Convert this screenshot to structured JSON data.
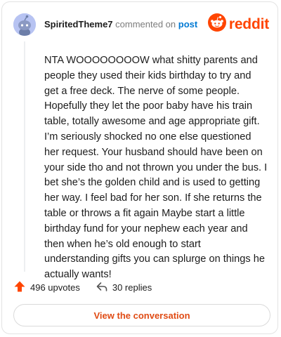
{
  "header": {
    "username": "SpiritedTheme7",
    "action_text": " commented on ",
    "post_link": "post",
    "brand_name": "reddit",
    "brand_icon": "reddit-logo-icon",
    "avatar_icon": "snoo-avatar-icon"
  },
  "comment": {
    "body": "NTA WOOOOOOOOW what shitty parents and people they used their kids birthday to try and get a free deck. The nerve of some people. Hopefully they let the poor baby have his train table, totally awesome and age appropriate gift. I’m seriously shocked no one else questioned her request. Your husband should have been on your side tho and not thrown you under the bus. I bet she’s the golden child and is used to getting her way. I feel bad for her son. If she returns the table or throws a fit again Maybe start a little birthday fund for your nephew each year and then when he’s old enough to start understanding gifts you can splurge on things he actually wants!"
  },
  "stats": {
    "upvotes": "496 upvotes",
    "upvote_icon": "upvote-arrow-icon",
    "replies": "30 replies",
    "reply_icon": "reply-arrow-icon"
  },
  "cta": {
    "label": "View the conversation"
  },
  "colors": {
    "brand": "#ff4500",
    "link": "#0079d3",
    "cta_text": "#e04b14",
    "avatar_bg": "#b7c3f2"
  }
}
